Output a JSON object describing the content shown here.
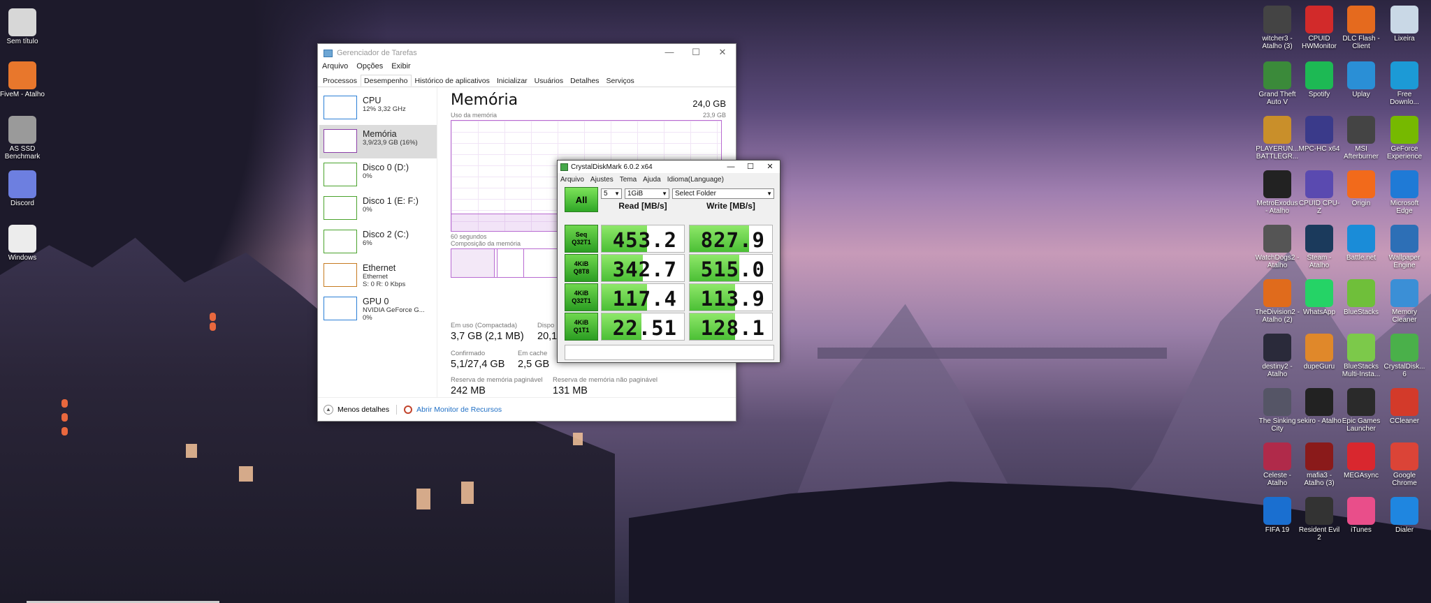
{
  "desktop_icons": [
    {
      "id": "sem-titulo",
      "label": "Sem título",
      "icon": "text-file-icon",
      "color": "#d7d7d7"
    },
    {
      "id": "fivem",
      "label": "FiveM - Atalho",
      "icon": "fivem-icon",
      "color": "#e8772c"
    },
    {
      "id": "as-ssd",
      "label": "AS SSD Benchmark",
      "icon": "as-ssd-icon",
      "color": "#9a9a9a"
    },
    {
      "id": "discord",
      "label": "Discord",
      "icon": "discord-icon",
      "color": "#6d7fe0"
    },
    {
      "id": "windows",
      "label": "Windows",
      "icon": "document-icon",
      "color": "#ececec"
    },
    {
      "id": "witcher3",
      "label": "witcher3 - Atalho (3)",
      "icon": "witcher-icon",
      "color": "#444"
    },
    {
      "id": "cpuid-hwmonitor",
      "label": "CPUID HWMonitor",
      "icon": "hwmonitor-icon",
      "color": "#d22a2a"
    },
    {
      "id": "dlc-client",
      "label": "DLC Flash - Client",
      "icon": "dlc-icon",
      "color": "#e56a1e"
    },
    {
      "id": "lixeira",
      "label": "Lixeira",
      "icon": "recycle-bin-icon",
      "color": "#c9d8e6"
    },
    {
      "id": "gta5",
      "label": "Grand Theft Auto V",
      "icon": "gta-icon",
      "color": "#3b8a3a"
    },
    {
      "id": "spotify",
      "label": "Spotify",
      "icon": "spotify-icon",
      "color": "#1db954"
    },
    {
      "id": "uplay",
      "label": "Uplay",
      "icon": "uplay-icon",
      "color": "#2a8fd6"
    },
    {
      "id": "free-download",
      "label": "Free Downlo...",
      "icon": "free-download-icon",
      "color": "#1c9ad6"
    },
    {
      "id": "pubg",
      "label": "PLAYERUN... BATTLEGR...",
      "icon": "pubg-icon",
      "color": "#c98f2a"
    },
    {
      "id": "mpc-hc",
      "label": "MPC-HC x64",
      "icon": "mpc-icon",
      "color": "#3a3a8a"
    },
    {
      "id": "msi-afterburner",
      "label": "MSI Afterburner",
      "icon": "afterburner-icon",
      "color": "#444"
    },
    {
      "id": "geforce",
      "label": "GeForce Experience",
      "icon": "nvidia-icon",
      "color": "#76b900"
    },
    {
      "id": "metro",
      "label": "MetroExodus - Atalho",
      "icon": "metro-icon",
      "color": "#222"
    },
    {
      "id": "cpuz",
      "label": "CPUID CPU-Z",
      "icon": "cpuz-icon",
      "color": "#5a4ab0"
    },
    {
      "id": "origin",
      "label": "Origin",
      "icon": "origin-icon",
      "color": "#f26a1b"
    },
    {
      "id": "edge",
      "label": "Microsoft Edge",
      "icon": "edge-icon",
      "color": "#1f7ad6"
    },
    {
      "id": "watchdogs2",
      "label": "WatchDogs2 - Atalho",
      "icon": "watchdogs-icon",
      "color": "#555"
    },
    {
      "id": "steam",
      "label": "Steam - Atalho",
      "icon": "steam-icon",
      "color": "#1b3a5c"
    },
    {
      "id": "battlenet",
      "label": "Battle.net",
      "icon": "battlenet-icon",
      "color": "#1a8cd8"
    },
    {
      "id": "wallpaper-engine",
      "label": "Wallpaper Engine",
      "icon": "wallpaper-engine-icon",
      "color": "#2d6fb6"
    },
    {
      "id": "division2",
      "label": "TheDivision2 - Atalho (2)",
      "icon": "division-icon",
      "color": "#e06b1c"
    },
    {
      "id": "whatsapp",
      "label": "WhatsApp",
      "icon": "whatsapp-icon",
      "color": "#25d366"
    },
    {
      "id": "bluestacks",
      "label": "BlueStacks",
      "icon": "bluestacks-icon",
      "color": "#6fbf3a"
    },
    {
      "id": "memory-cleaner",
      "label": "Memory Cleaner",
      "icon": "memory-cleaner-icon",
      "color": "#3b8fd6"
    },
    {
      "id": "destiny2",
      "label": "destiny2 - Atalho",
      "icon": "destiny-icon",
      "color": "#2a2a3a"
    },
    {
      "id": "dupeguru",
      "label": "dupeGuru",
      "icon": "dupeguru-icon",
      "color": "#e0882a"
    },
    {
      "id": "bluestacks-multi",
      "label": "BlueStacks Multi-Insta...",
      "icon": "bluestacks-multi-icon",
      "color": "#7cc94a"
    },
    {
      "id": "crystaldisk6",
      "label": "CrystalDisk... 6",
      "icon": "crystaldisk-icon",
      "color": "#4ab04a"
    },
    {
      "id": "sinking-city",
      "label": "The Sinking City",
      "icon": "sinking-city-icon",
      "color": "#556"
    },
    {
      "id": "sekiro",
      "label": "sekiro - Atalho",
      "icon": "sekiro-icon",
      "color": "#222"
    },
    {
      "id": "epic",
      "label": "Epic Games Launcher",
      "icon": "epic-icon",
      "color": "#2a2a2a"
    },
    {
      "id": "ccleaner",
      "label": "CCleaner",
      "icon": "ccleaner-icon",
      "color": "#d33a2a"
    },
    {
      "id": "celeste",
      "label": "Celeste - Atalho",
      "icon": "celeste-icon",
      "color": "#b02a4a"
    },
    {
      "id": "mafia3",
      "label": "mafia3 - Atalho (3)",
      "icon": "mafia-icon",
      "color": "#8a1a1a"
    },
    {
      "id": "megasync",
      "label": "MEGAsync",
      "icon": "mega-icon",
      "color": "#d9272e"
    },
    {
      "id": "chrome",
      "label": "Google Chrome",
      "icon": "chrome-icon",
      "color": "#db4437"
    },
    {
      "id": "fifa19",
      "label": "FIFA 19",
      "icon": "fifa-icon",
      "color": "#1a6fd0"
    },
    {
      "id": "resident-evil-2",
      "label": "Resident Evil 2",
      "icon": "resident-evil-icon",
      "color": "#333"
    },
    {
      "id": "itunes",
      "label": "iTunes",
      "icon": "itunes-icon",
      "color": "#e94e8a"
    },
    {
      "id": "dialer",
      "label": "Dialer",
      "icon": "dialer-icon",
      "color": "#1f86e0"
    }
  ],
  "taskmgr": {
    "title": "Gerenciador de Tarefas",
    "window_buttons": {
      "minimize": "—",
      "maximize": "☐",
      "close": "✕"
    },
    "menu": [
      "Arquivo",
      "Opções",
      "Exibir"
    ],
    "tabs": [
      "Processos",
      "Desempenho",
      "Histórico de aplicativos",
      "Inicializar",
      "Usuários",
      "Detalhes",
      "Serviços"
    ],
    "active_tab": "Desempenho",
    "perf_items": [
      {
        "name": "CPU",
        "sub1": "12% 3,32 GHz",
        "sub2": "",
        "sub3": "",
        "kind": "cpu"
      },
      {
        "name": "Memória",
        "sub1": "3,9/23,9 GB (16%)",
        "sub2": "",
        "sub3": "",
        "kind": "mem"
      },
      {
        "name": "Disco 0 (D:)",
        "sub1": "0%",
        "sub2": "",
        "sub3": "",
        "kind": "disk"
      },
      {
        "name": "Disco 1 (E: F:)",
        "sub1": "0%",
        "sub2": "",
        "sub3": "",
        "kind": "disk"
      },
      {
        "name": "Disco 2 (C:)",
        "sub1": "6%",
        "sub2": "",
        "sub3": "",
        "kind": "disk"
      },
      {
        "name": "Ethernet",
        "sub1": "Ethernet",
        "sub2": "S: 0 R: 0 Kbps",
        "sub3": "",
        "kind": "eth"
      },
      {
        "name": "GPU 0",
        "sub1": "NVIDIA GeForce G...",
        "sub2": "0%",
        "sub3": "",
        "kind": "gpu"
      }
    ],
    "detail": {
      "title": "Memória",
      "total": "24,0 GB",
      "usage_label": "Uso da memória",
      "usage_max": "23,9 GB",
      "time_label": "60 segundos",
      "composition_label": "Composição da memória",
      "usage_fraction": 0.16,
      "stats": {
        "in_use_label": "Em uso (Compactada)",
        "in_use_value": "3,7 GB (2,1 MB)",
        "available_label": "Dispo",
        "available_value": "20,1",
        "committed_label": "Confirmado",
        "committed_value": "5,1/27,4 GB",
        "cached_label": "Em cache",
        "cached_value": "2,5 GB",
        "paged_label": "Reserva de memória paginável",
        "paged_value": "242 MB",
        "nonpaged_label": "Reserva de memória não paginável",
        "nonpaged_value": "131 MB"
      }
    },
    "footer": {
      "less_details": "Menos detalhes",
      "resource_monitor": "Abrir Monitor de Recursos"
    }
  },
  "cdm": {
    "title": "CrystalDiskMark 6.0.2 x64",
    "window_buttons": {
      "minimize": "—",
      "maximize": "☐",
      "close": "✕"
    },
    "menu": [
      "Arquivo",
      "Ajustes",
      "Tema",
      "Ajuda",
      "Idioma(Language)"
    ],
    "all_button": "All",
    "count": "5",
    "size": "1GiB",
    "folder": "Select Folder",
    "read_header": "Read [MB/s]",
    "write_header": "Write [MB/s]",
    "rows": [
      {
        "label1": "Seq",
        "label2": "Q32T1",
        "read": "453.2",
        "write": "827.9",
        "read_frac": 0.55,
        "write_frac": 0.72
      },
      {
        "label1": "4KiB",
        "label2": "Q8T8",
        "read": "342.7",
        "write": "515.0",
        "read_frac": 0.5,
        "write_frac": 0.6
      },
      {
        "label1": "4KiB",
        "label2": "Q32T1",
        "read": "117.4",
        "write": "113.9",
        "read_frac": 0.55,
        "write_frac": 0.55
      },
      {
        "label1": "4KiB",
        "label2": "Q1T1",
        "read": "22.51",
        "write": "128.1",
        "read_frac": 0.48,
        "write_frac": 0.55
      }
    ],
    "comment": ""
  }
}
